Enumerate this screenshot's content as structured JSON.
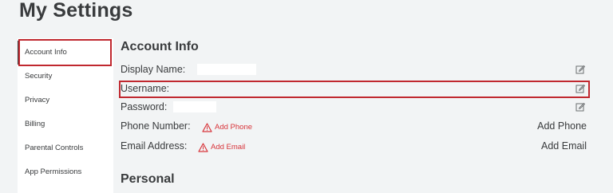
{
  "page_title": "My Settings",
  "sidebar": {
    "items": [
      {
        "label": "Account Info"
      },
      {
        "label": "Security"
      },
      {
        "label": "Privacy"
      },
      {
        "label": "Billing"
      },
      {
        "label": "Parental Controls"
      },
      {
        "label": "App Permissions"
      }
    ]
  },
  "account_info": {
    "title": "Account Info",
    "display_name_label": "Display Name:",
    "username_label": "Username:",
    "password_label": "Password:",
    "phone_label": "Phone Number:",
    "phone_warning": "Add Phone",
    "phone_action": "Add Phone",
    "email_label": "Email Address:",
    "email_warning": "Add Email",
    "email_action": "Add Email"
  },
  "personal": {
    "title": "Personal"
  },
  "colors": {
    "highlight": "#c0282f",
    "warning": "#d8363c",
    "text": "#393b3d",
    "background": "#f2f4f5"
  }
}
